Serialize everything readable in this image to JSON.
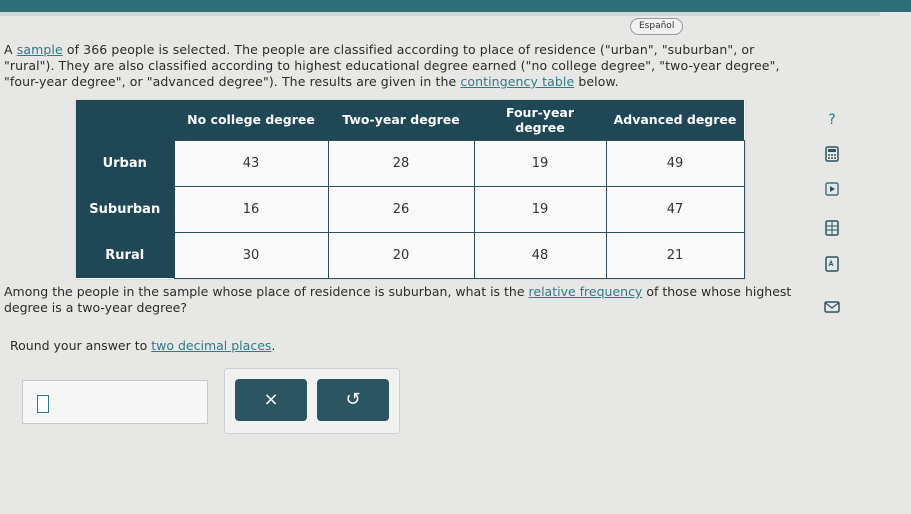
{
  "header": {
    "language_button": "Español"
  },
  "problem": {
    "p1": "A ",
    "p1_link": "sample",
    "p2": " of 366 people is selected. The people are classified according to place of residence (\"urban\", \"suburban\", or \"rural\"). They are also classified according to highest educational degree earned (\"no college degree\", \"two-year degree\", \"four-year degree\", or \"advanced degree\"). The results are given in the ",
    "p2_link": "contingency table",
    "p3": " below."
  },
  "table": {
    "columns": [
      "No college degree",
      "Two-year degree",
      "Four-year degree",
      "Advanced degree"
    ],
    "rows": [
      {
        "label": "Urban",
        "values": [
          "43",
          "28",
          "19",
          "49"
        ]
      },
      {
        "label": "Suburban",
        "values": [
          "16",
          "26",
          "19",
          "47"
        ]
      },
      {
        "label": "Rural",
        "values": [
          "30",
          "20",
          "48",
          "21"
        ]
      }
    ]
  },
  "question": {
    "q1": "Among the people in the sample whose place of residence is suburban, what is the ",
    "q1_link": "relative frequency",
    "q2": " of those whose highest degree is a two-year degree?"
  },
  "round": {
    "text": "Round your answer to ",
    "link": "two decimal places",
    "end": "."
  },
  "answer": {
    "value": ""
  },
  "buttons": {
    "clear": "×",
    "undo": "↺"
  },
  "side_tools": [
    "help-icon",
    "calculator-icon",
    "play-icon",
    "grid-icon",
    "dictionary-icon",
    "mail-icon"
  ]
}
